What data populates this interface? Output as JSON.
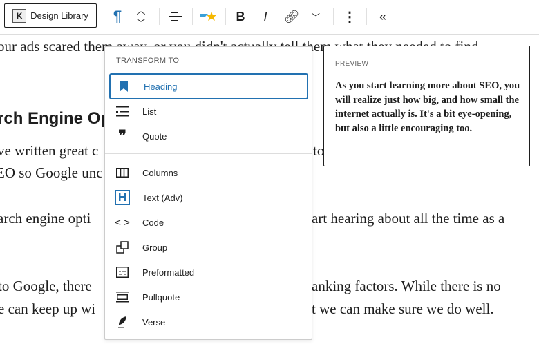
{
  "toolbar": {
    "design_library_label": "Design Library",
    "icons": [
      "design-library-icon",
      "paragraph-icon",
      "move-up-icon",
      "move-down-icon",
      "align-icon",
      "highlight-star-icon",
      "bold-icon",
      "italic-icon",
      "link-icon",
      "more-formats-chevron-icon",
      "options-icon",
      "collapse-icon"
    ]
  },
  "content": {
    "lines": [
      {
        "left": "our ads scared them away, or you didn't actually tell them what they needed to find"
      },
      {
        "left": "rch Engine Op"
      },
      {
        "left": "ve written great c",
        "right": "to"
      },
      {
        "left": "EO so Google unc"
      },
      {
        "left": "arch engine opti",
        "right": "art hearing about all the time as a"
      },
      {
        "left": " to Google, there",
        "right": "anking factors. While there is no"
      },
      {
        "left": "e can keep up wi",
        "right": "t we can make sure we do well."
      }
    ]
  },
  "transform": {
    "title": "TRANSFORM TO",
    "accent": "#2271b1",
    "items": [
      {
        "label": "Heading",
        "icon": "bookmark-icon",
        "selected": true
      },
      {
        "label": "List",
        "icon": "list-icon"
      },
      {
        "label": "Quote",
        "icon": "quote-icon"
      },
      {
        "label": "Columns",
        "icon": "columns-icon"
      },
      {
        "label": "Text (Adv)",
        "icon": "text-adv-icon"
      },
      {
        "label": "Code",
        "icon": "code-icon"
      },
      {
        "label": "Group",
        "icon": "group-icon"
      },
      {
        "label": "Preformatted",
        "icon": "preformatted-icon"
      },
      {
        "label": "Pullquote",
        "icon": "pullquote-icon"
      },
      {
        "label": "Verse",
        "icon": "verse-icon"
      }
    ]
  },
  "preview": {
    "title": "PREVIEW",
    "body": "As you start learning more about SEO, you will realize just how big, and how small the internet actually is. It's a bit eye-opening, but also a little encouraging too."
  }
}
